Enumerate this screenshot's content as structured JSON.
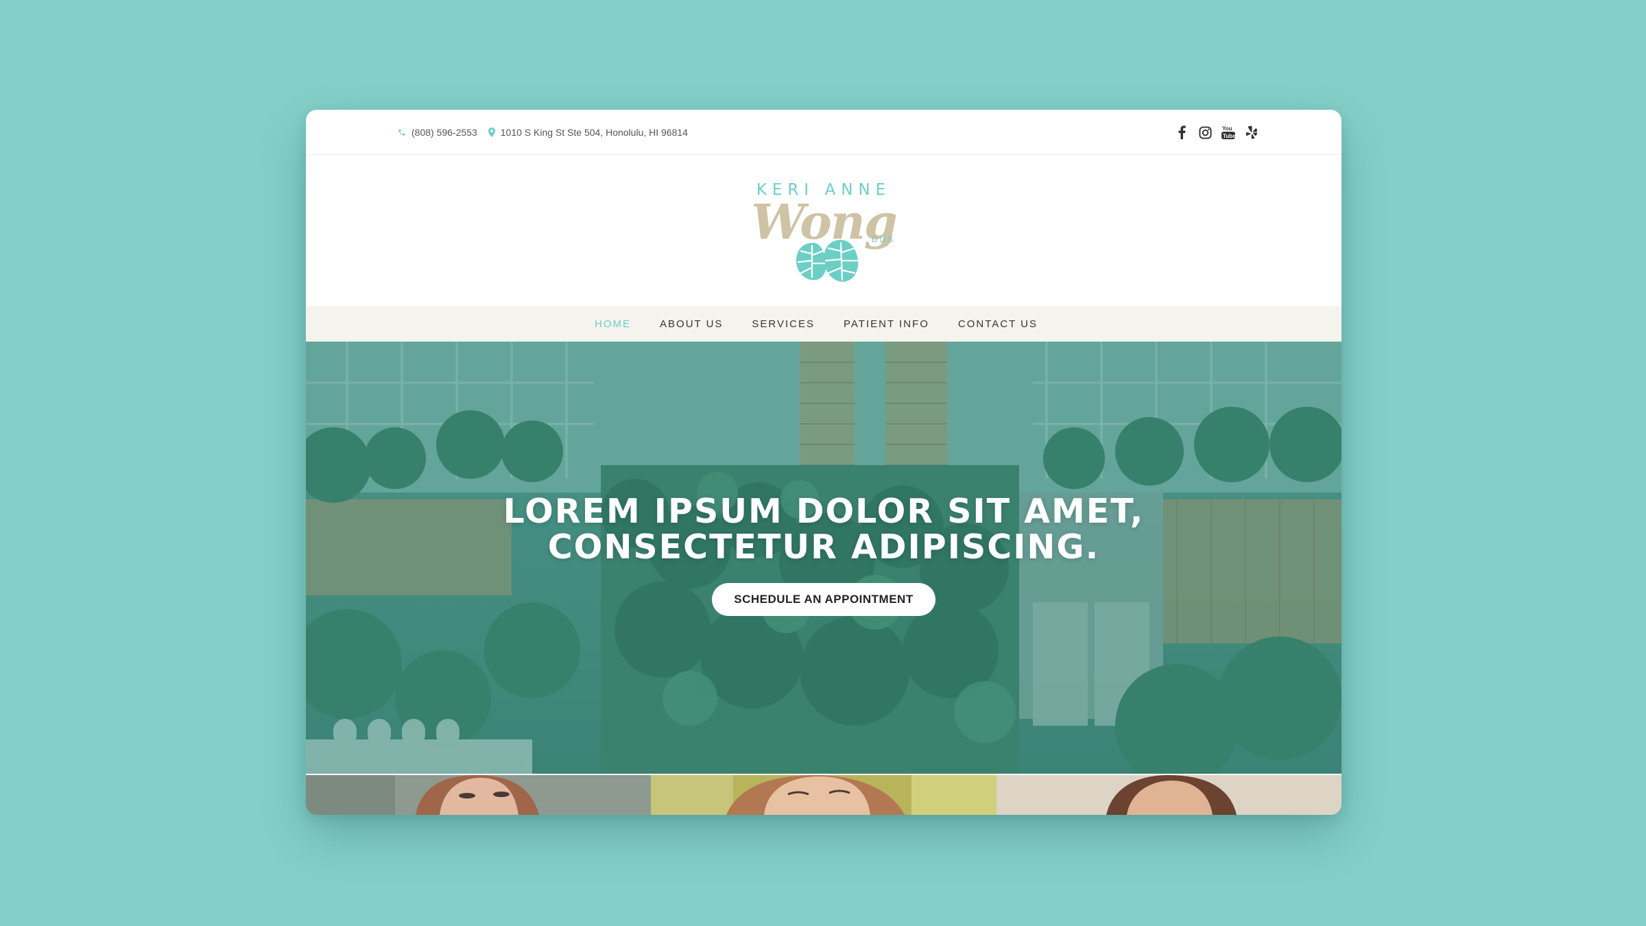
{
  "topbar": {
    "phone": "(808) 596-2553",
    "address": "1010 S King St Ste 504, Honolulu, HI 96814",
    "social": [
      "facebook-icon",
      "instagram-icon",
      "youtube-icon",
      "yelp-icon"
    ]
  },
  "logo": {
    "kicker": "KERI ANNE",
    "script": "Wong",
    "suffix": "DDS"
  },
  "nav": {
    "items": [
      {
        "label": "HOME",
        "active": true
      },
      {
        "label": "ABOUT US"
      },
      {
        "label": "SERVICES"
      },
      {
        "label": "PATIENT INFO"
      },
      {
        "label": "CONTACT US"
      }
    ]
  },
  "hero": {
    "title_line1": "LOREM IPSUM DOLOR SIT AMET,",
    "title_line2": "CONSECTETUR ADIPISCING.",
    "cta_label": "SCHEDULE AN APPOINTMENT"
  },
  "colors": {
    "background": "#84d0c9",
    "accent": "#6ccfc5",
    "logo_script": "#cfc3a6",
    "nav_bg": "#f5f3ee"
  }
}
